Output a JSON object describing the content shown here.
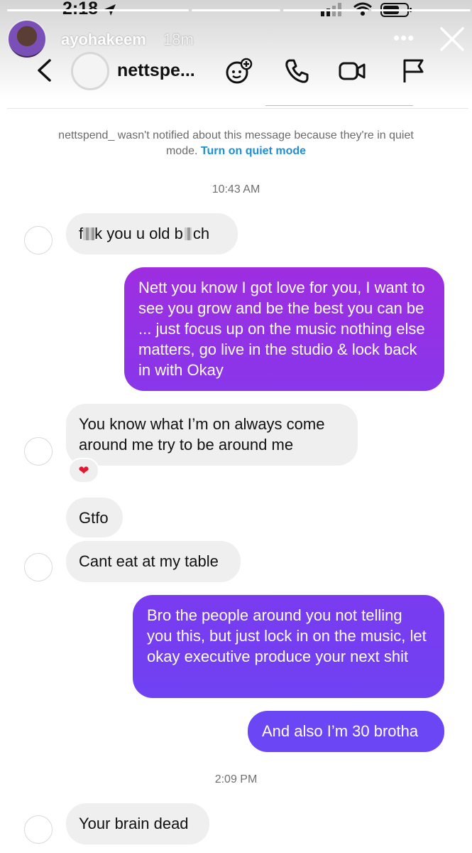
{
  "status_bar": {
    "time": "2:18"
  },
  "story": {
    "username": "ayohakeem",
    "age": "18m",
    "more_label": "•••"
  },
  "dm_header": {
    "name": "nettspe..."
  },
  "notice": {
    "text": "nettspend_ wasn't notified about this message because they're in quiet mode.",
    "link": "Turn on quiet mode"
  },
  "timestamps": [
    "10:43 AM",
    "2:09 PM"
  ],
  "messages": [
    {
      "side": "in",
      "text_a": "f",
      "text_b": "k you u old b",
      "text_c": "ch"
    },
    {
      "side": "out",
      "text": "Nett you know I got love for you, I want to see you grow and be the best you can be ... just focus up on the music nothing else matters, go live in the studio & lock back in with Okay"
    },
    {
      "side": "in",
      "text": "You know what I’m on always come around me try to be around me",
      "reaction": "❤"
    },
    {
      "side": "in",
      "text": "Gtfo"
    },
    {
      "side": "in",
      "text": "Cant eat at my table"
    },
    {
      "side": "out",
      "text": "Bro the people around you not telling you this, but just lock in on the music, let okay executive produce your next shit"
    },
    {
      "side": "out",
      "text": "And also I’m 30 brotha"
    },
    {
      "side": "in",
      "text": "Your brain dead"
    }
  ],
  "colors": {
    "bubble_out_top": "#9e2ee0",
    "bubble_out_mid": "#7b3cf0",
    "bubble_out_bottom": "#6b46f4",
    "bubble_in": "#efefef",
    "link": "#1f8fd6"
  }
}
